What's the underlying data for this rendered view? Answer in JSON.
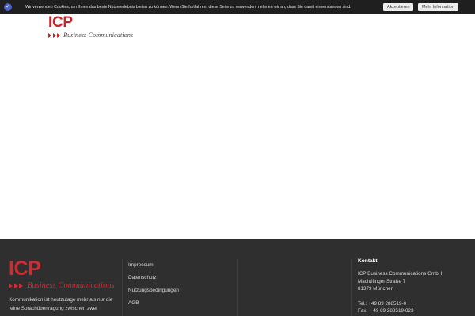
{
  "cookie_bar": {
    "text": "Wir verwenden Cookies, um Ihnen das beste Nutzererlebnis bieten zu können. Wenn Sie fortfahren, diese Seite zu verwenden, nehmen wir an, dass Sie damit einverstanden sind.",
    "accept_label": "Akzeptieren",
    "info_label": "Mehr Information",
    "icon": "check-icon"
  },
  "header": {
    "logo_text": "ICP",
    "logo_tagline": "Business Communications"
  },
  "footer": {
    "logo_text": "ICP",
    "logo_tagline": "Business Communications",
    "description": "Kommunikation ist heutzutage mehr als nur die reine Sprachübertragung zwischen zwei",
    "links": [
      "Impressum",
      "Datenschutz",
      "Nutzungsbedingungen",
      "AGB"
    ],
    "contact": {
      "title": "Kontakt",
      "company": "ICP Business Communications GmbH",
      "street": "Machtlfinger Straße 7",
      "city": "81379 München",
      "phone": "Tel.: +49 89 288519-0",
      "fax": "Fax: + 49 89 288519-823"
    }
  },
  "colors": {
    "brand_red": "#c8222b",
    "footer_bg": "#2f2f2f",
    "cookie_bg": "#1f1f1f"
  }
}
